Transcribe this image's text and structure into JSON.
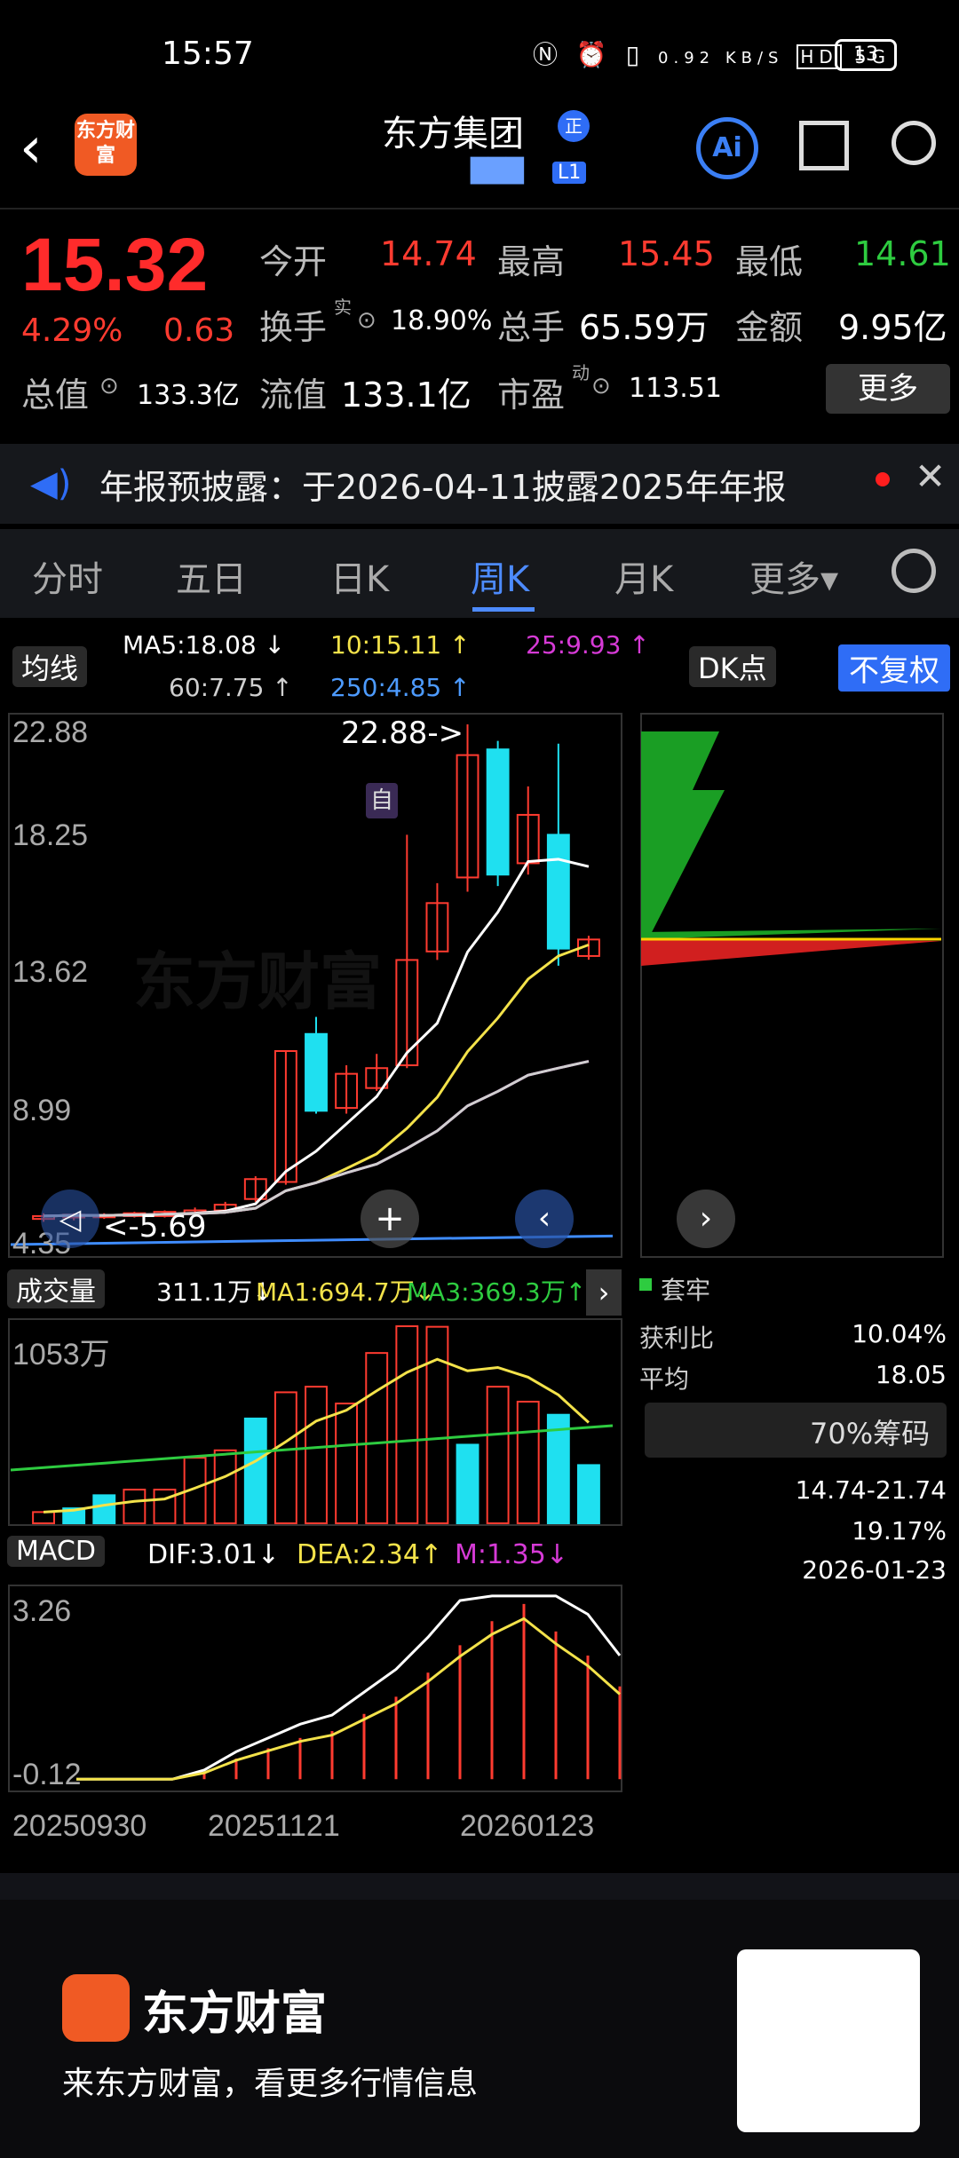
{
  "status": {
    "time": "15:57",
    "net": "0.92 KB/S",
    "hd": "HD",
    "signal": "5G",
    "battery": "13"
  },
  "header": {
    "brand_logo": "东方财富",
    "stock_name": "东方集团",
    "q_badge": "正",
    "code_blur": "███",
    "level": "L1",
    "ai_label": "Ai"
  },
  "quote": {
    "price": "15.32",
    "pct": "4.29%",
    "chg": "0.63",
    "open_label": "今开",
    "open": "14.74",
    "high_label": "最高",
    "high": "15.45",
    "low_label": "最低",
    "low": "14.61",
    "turnover_label": "换手",
    "turnover_sup": "实",
    "turnover": "18.90%",
    "vol_label": "总手",
    "vol": "65.59万",
    "amount_label": "金额",
    "amount": "9.95亿",
    "mktcap_label": "总值",
    "mktcap": "133.3亿",
    "float_label": "流值",
    "float": "133.1亿",
    "pe_label": "市盈",
    "pe_sup": "动",
    "pe": "113.51",
    "more": "更多"
  },
  "notice": {
    "text": "年报预披露：于2026-04-11披露2025年年报"
  },
  "tabs": [
    "分时",
    "五日",
    "日K",
    "周K",
    "月K",
    "更多▾"
  ],
  "active_tab": "周K",
  "ma": {
    "label": "均线",
    "ma5": "MA5:18.08 ↓",
    "ma10": "10:15.11 ↑",
    "ma25": "25:9.93 ↑",
    "ma60": "60:7.75 ↑",
    "ma250": "250:4.85 ↑",
    "dk": "DK点",
    "fq": "不复权"
  },
  "price_axis": [
    "22.88",
    "18.25",
    "13.62",
    "8.99",
    "4.35"
  ],
  "annot": {
    "high": "22.88->",
    "low": "<-5.69",
    "event": "自"
  },
  "watermark": "东方财富",
  "vol_panel": {
    "label": "成交量",
    "val": "311.1万↓",
    "ma1": "MA1:694.7万↓",
    "ma3": "MA3:369.3万↑",
    "axis_top": "1053万"
  },
  "macd_panel": {
    "label": "MACD",
    "dif": "DIF:3.01↓",
    "dea": "DEA:2.34↑",
    "m": "M:1.35↓",
    "axis_top": "3.26",
    "axis_bot": "-0.12"
  },
  "dates": [
    "20250930",
    "20251121",
    "20260123"
  ],
  "side": {
    "trap_label": "套牢",
    "profit_label": "获利比",
    "profit_val": "10.04%",
    "avg_label": "平均",
    "avg_val": "18.05",
    "chip_btn": "70%筹码",
    "range_val": "14.74-21.74",
    "conc_val": "19.17%",
    "date_val": "2026-01-23"
  },
  "footer": {
    "name": "东方财富",
    "slogan": "来东方财富，看更多行情信息"
  },
  "colors": {
    "up": "#ff3b30",
    "down": "#1fe0f0",
    "ma5": "#ffffff",
    "ma10": "#f3e24a",
    "ma25": "#d63ad6",
    "ma60": "#cfcfcf",
    "ma250": "#3f8cff"
  },
  "chart_data": {
    "type": "candlestick",
    "x": [
      "20250930",
      "20251121",
      "20260123"
    ],
    "ylim": [
      4.35,
      22.88
    ],
    "candles": [
      {
        "o": 5.5,
        "c": 5.6,
        "h": 5.7,
        "l": 5.4
      },
      {
        "o": 5.55,
        "c": 5.65,
        "h": 5.7,
        "l": 5.45
      },
      {
        "o": 5.6,
        "c": 5.62,
        "h": 5.7,
        "l": 5.5
      },
      {
        "o": 5.6,
        "c": 5.7,
        "h": 5.75,
        "l": 5.55
      },
      {
        "o": 5.6,
        "c": 5.75,
        "h": 5.8,
        "l": 5.55
      },
      {
        "o": 5.7,
        "c": 5.8,
        "h": 5.9,
        "l": 5.6
      },
      {
        "o": 5.8,
        "c": 6.0,
        "h": 6.1,
        "l": 5.7
      },
      {
        "o": 6.2,
        "c": 6.9,
        "h": 7.0,
        "l": 6.1
      },
      {
        "o": 6.8,
        "c": 11.4,
        "h": 11.4,
        "l": 6.7
      },
      {
        "o": 12.0,
        "c": 9.3,
        "h": 12.6,
        "l": 9.2
      },
      {
        "o": 9.4,
        "c": 10.6,
        "h": 10.9,
        "l": 9.2
      },
      {
        "o": 10.1,
        "c": 10.8,
        "h": 11.3,
        "l": 10.0
      },
      {
        "o": 10.9,
        "c": 14.6,
        "h": 19.0,
        "l": 10.8
      },
      {
        "o": 14.9,
        "c": 16.6,
        "h": 17.3,
        "l": 14.6
      },
      {
        "o": 17.5,
        "c": 21.8,
        "h": 22.88,
        "l": 17.0
      },
      {
        "o": 22.0,
        "c": 17.6,
        "h": 22.3,
        "l": 17.2
      },
      {
        "o": 18.0,
        "c": 19.7,
        "h": 20.7,
        "l": 17.6
      },
      {
        "o": 19.0,
        "c": 15.0,
        "h": 22.2,
        "l": 14.4
      },
      {
        "o": 14.74,
        "c": 15.32,
        "h": 15.45,
        "l": 14.61
      }
    ],
    "volume": [
      60,
      80,
      150,
      180,
      180,
      350,
      390,
      560,
      700,
      730,
      640,
      910,
      1053,
      1050,
      420,
      730,
      650,
      580,
      311.1
    ],
    "volume_up": [
      1,
      0,
      0,
      1,
      1,
      1,
      1,
      0,
      1,
      1,
      1,
      1,
      1,
      1,
      0,
      1,
      1,
      0,
      0
    ],
    "macd": [
      0.0,
      0.0,
      0.0,
      0.0,
      0.1,
      0.3,
      0.45,
      0.6,
      0.7,
      0.95,
      1.2,
      1.55,
      1.95,
      2.3,
      2.55,
      2.15,
      1.8,
      1.35
    ]
  }
}
